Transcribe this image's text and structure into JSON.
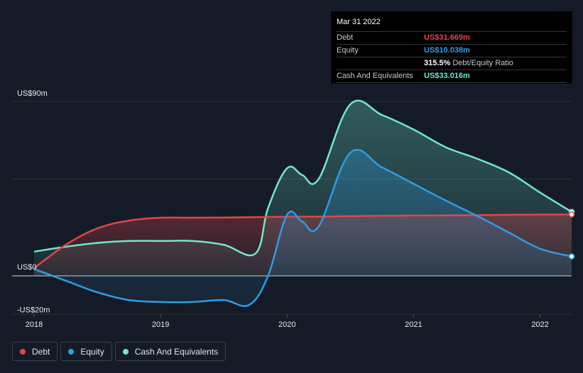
{
  "tooltip": {
    "date": "Mar 31 2022",
    "debt_label": "Debt",
    "debt_value": "US$31.669m",
    "equity_label": "Equity",
    "equity_value": "US$10.038m",
    "ratio_value": "315.5%",
    "ratio_label": "Debt/Equity Ratio",
    "cash_label": "Cash And Equivalents",
    "cash_value": "US$33.016m"
  },
  "legend": [
    {
      "label": "Debt",
      "color": "#e0454c"
    },
    {
      "label": "Equity",
      "color": "#2d9de5"
    },
    {
      "label": "Cash And Equivalents",
      "color": "#6ee7cf"
    }
  ],
  "chart_data": {
    "type": "area",
    "y_axis_labels": [
      "US$90m",
      "US$0",
      "-US$20m"
    ],
    "ylim": [
      -20,
      90
    ],
    "x_ticks": [
      2018,
      2019,
      2020,
      2021,
      2022
    ],
    "x_tick_labels": [
      "2018",
      "2019",
      "2020",
      "2021",
      "2022"
    ],
    "xlim": [
      2018.0,
      2022.25
    ],
    "grid": true,
    "series": [
      {
        "name": "Debt",
        "color": "#e0454c",
        "points": [
          [
            2018.0,
            4
          ],
          [
            2018.25,
            16
          ],
          [
            2018.5,
            24.5
          ],
          [
            2018.75,
            28.5
          ],
          [
            2019.0,
            30
          ],
          [
            2019.25,
            30
          ],
          [
            2019.5,
            30.1
          ],
          [
            2019.75,
            30.3
          ],
          [
            2020.0,
            30.5
          ],
          [
            2020.25,
            30.6
          ],
          [
            2020.5,
            30.8
          ],
          [
            2020.75,
            31
          ],
          [
            2021.0,
            31.1
          ],
          [
            2021.25,
            31.2
          ],
          [
            2021.5,
            31.3
          ],
          [
            2021.75,
            31.5
          ],
          [
            2022.0,
            31.6
          ],
          [
            2022.25,
            31.669
          ]
        ]
      },
      {
        "name": "Equity",
        "color": "#2d9de5",
        "points": [
          [
            2018.0,
            3.5
          ],
          [
            2018.25,
            -2.5
          ],
          [
            2018.5,
            -8.5
          ],
          [
            2018.75,
            -12.5
          ],
          [
            2019.0,
            -13.5
          ],
          [
            2019.25,
            -13.5
          ],
          [
            2019.5,
            -12.5
          ],
          [
            2019.7,
            -15
          ],
          [
            2019.85,
            0
          ],
          [
            2020.0,
            31.5
          ],
          [
            2020.12,
            28
          ],
          [
            2020.25,
            25.5
          ],
          [
            2020.5,
            63.5
          ],
          [
            2020.75,
            56
          ],
          [
            2021.0,
            47.5
          ],
          [
            2021.25,
            39
          ],
          [
            2021.5,
            31
          ],
          [
            2021.75,
            22.5
          ],
          [
            2022.0,
            14
          ],
          [
            2022.25,
            10.038
          ]
        ]
      },
      {
        "name": "Cash And Equivalents",
        "color": "#6ee7cf",
        "points": [
          [
            2018.0,
            12.5
          ],
          [
            2018.25,
            15
          ],
          [
            2018.5,
            17
          ],
          [
            2018.75,
            18
          ],
          [
            2019.0,
            18
          ],
          [
            2019.25,
            18
          ],
          [
            2019.5,
            16
          ],
          [
            2019.75,
            11.5
          ],
          [
            2019.85,
            35
          ],
          [
            2020.0,
            55.5
          ],
          [
            2020.12,
            52
          ],
          [
            2020.25,
            50
          ],
          [
            2020.5,
            88.5
          ],
          [
            2020.75,
            83
          ],
          [
            2021.0,
            75.5
          ],
          [
            2021.25,
            66.5
          ],
          [
            2021.5,
            60.5
          ],
          [
            2021.75,
            53.5
          ],
          [
            2022.0,
            43
          ],
          [
            2022.25,
            33.016
          ]
        ]
      }
    ]
  }
}
